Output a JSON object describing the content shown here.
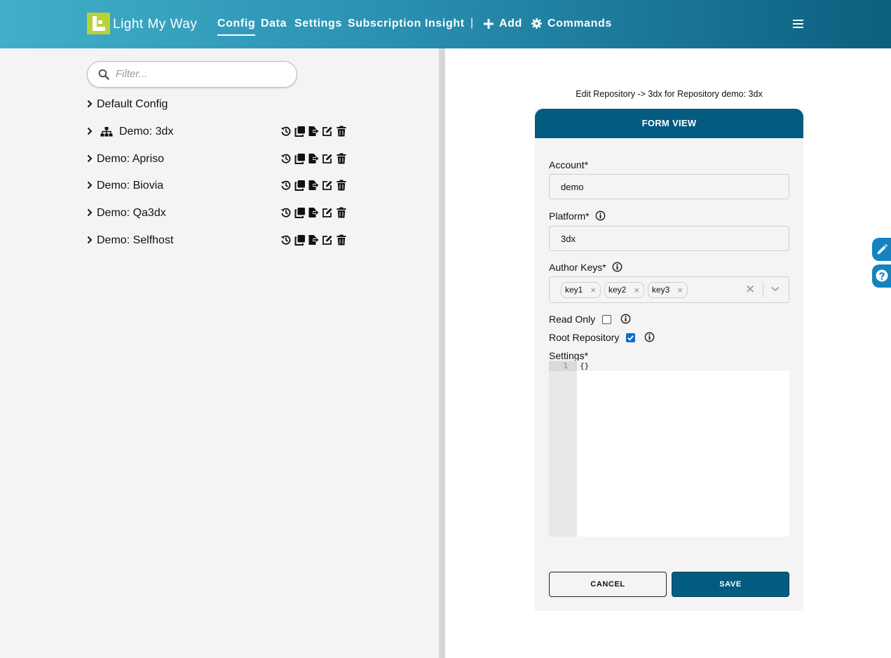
{
  "header": {
    "brand": "Light My Way",
    "nav": [
      "Config",
      "Data",
      "Settings",
      "Subscription",
      "Insight"
    ],
    "active_nav": "Config",
    "separator": "|",
    "add_label": "Add",
    "commands_label": "Commands"
  },
  "filter": {
    "placeholder": "Filter..."
  },
  "tree": {
    "default_config": "Default Config",
    "items": [
      {
        "label": "Demo: 3dx",
        "icon": "sitemap-icon"
      },
      {
        "label": "Demo: Apriso"
      },
      {
        "label": "Demo: Biovia"
      },
      {
        "label": "Demo: Qa3dx"
      },
      {
        "label": "Demo: Selfhost"
      }
    ],
    "row_actions": [
      "history-icon",
      "copy-icon",
      "export-icon",
      "edit-icon",
      "trash-icon"
    ]
  },
  "form": {
    "title": "Edit Repository -> 3dx for Repository demo: 3dx",
    "view_label": "FORM VIEW",
    "account_label": "Account*",
    "account_value": "demo",
    "platform_label": "Platform*",
    "platform_value": "3dx",
    "author_keys_label": "Author Keys*",
    "author_keys": [
      "key1",
      "key2",
      "key3"
    ],
    "read_only_label": "Read Only",
    "read_only": false,
    "root_repository_label": "Root Repository",
    "root_repository": true,
    "settings_label": "Settings*",
    "settings_line_number": "1",
    "settings_value": "{}",
    "cancel_label": "CANCEL",
    "save_label": "SAVE"
  },
  "colors": {
    "header_gradient_start": "#41afc9",
    "header_gradient_end": "#0c5f7f",
    "logo": "#b9d233",
    "primary": "#045b80",
    "side_tab": "#1583c0"
  }
}
